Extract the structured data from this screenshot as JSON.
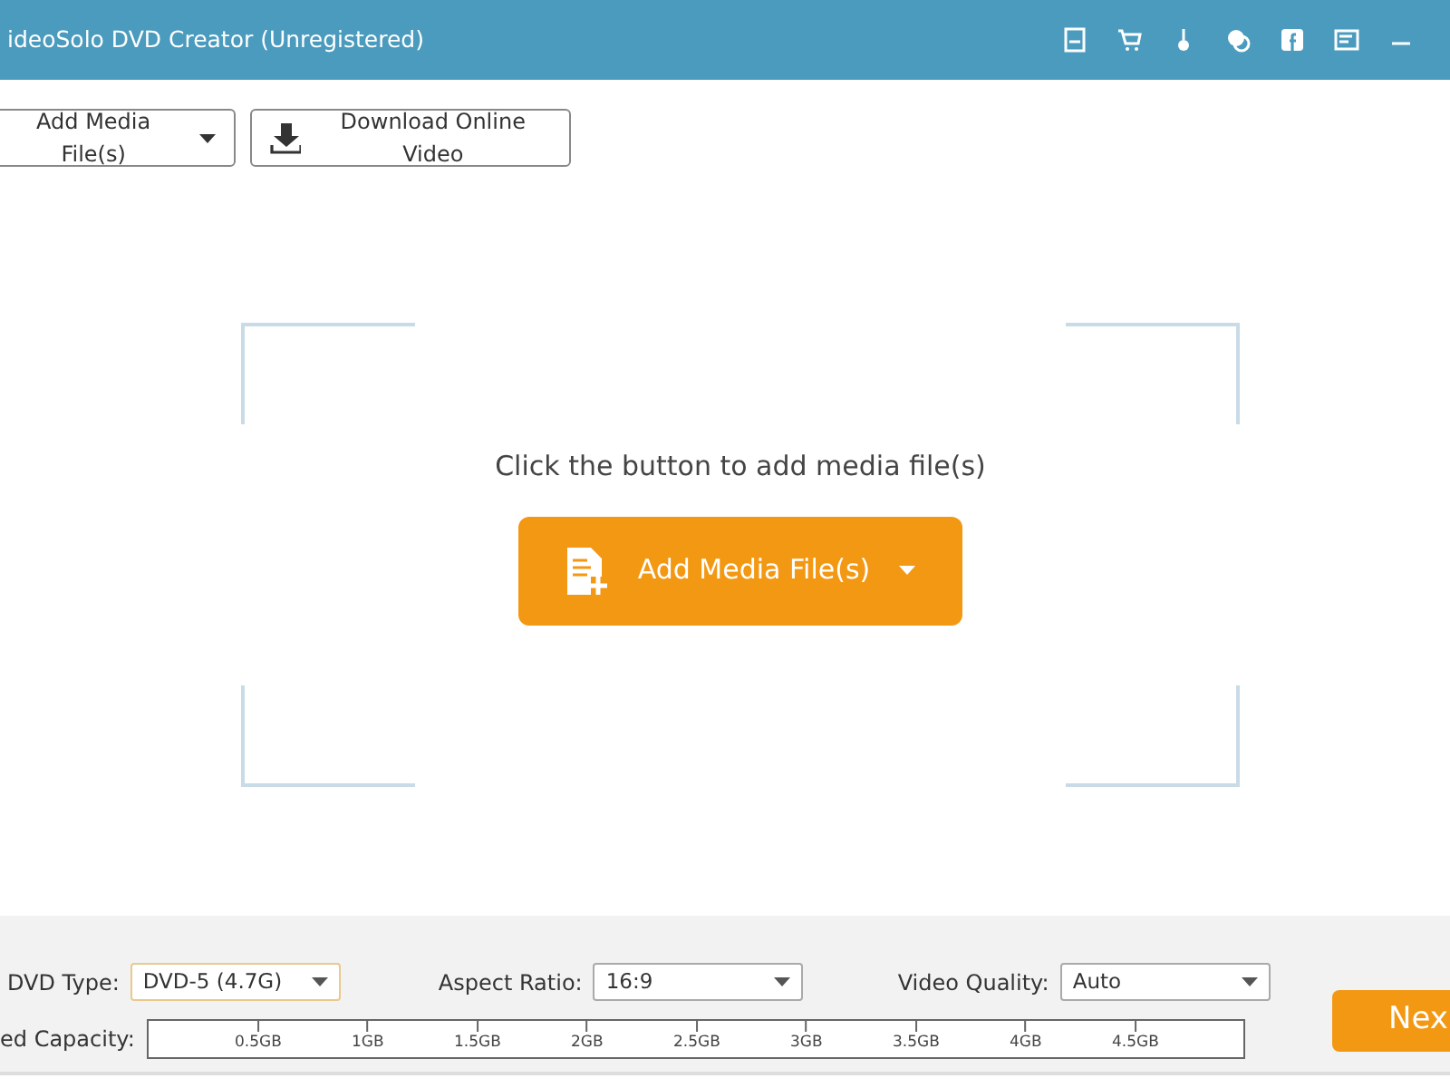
{
  "window": {
    "title": "ideoSolo DVD Creator (Unregistered)"
  },
  "toolbar": {
    "buttons": [
      {
        "kind": "dropdown",
        "label": "Add Media File(s)"
      },
      {
        "kind": "download",
        "label": "Download Online Video"
      }
    ]
  },
  "drop_area": {
    "prompt": "Click the button to add media file(s)",
    "button": "Add Media File(s)"
  },
  "settings": [
    {
      "label": "DVD Type:",
      "value": "DVD-5 (4.7G)",
      "focused": true
    },
    {
      "label": "Aspect Ratio:",
      "value": "16:9",
      "focused": false
    },
    {
      "label": "Video Quality:",
      "value": "Auto",
      "focused": false
    }
  ],
  "capacity": {
    "label": "ed Capacity:",
    "ticks": [
      "0.5GB",
      "1GB",
      "1.5GB",
      "2GB",
      "2.5GB",
      "3GB",
      "3.5GB",
      "4GB",
      "4.5GB"
    ]
  },
  "next_button": "Nex"
}
